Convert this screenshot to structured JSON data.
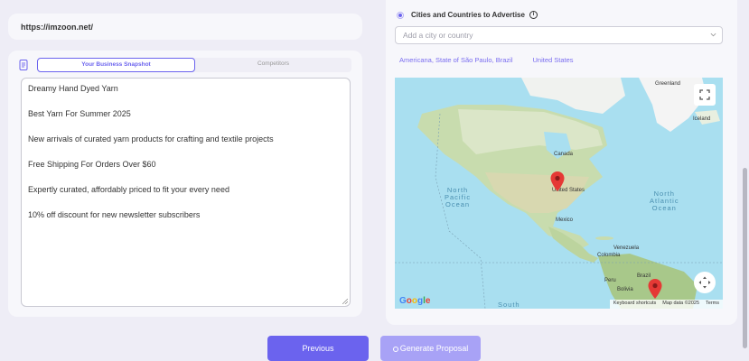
{
  "url_card": {
    "url": "https://imzoon.net/"
  },
  "snapshot": {
    "tabs": [
      {
        "label": "Your Business Snapshot",
        "active": true
      },
      {
        "label": "Competitors",
        "active": false
      }
    ],
    "lines": [
      "Dreamy Hand Dyed Yarn",
      "Best Yarn For Summer 2025",
      "New arrivals of curated yarn products for crafting and textile projects",
      "Free Shipping For Orders Over $60",
      "Expertly curated, affordably priced to fit your every need",
      "10% off discount for new newsletter subscribers"
    ]
  },
  "targeting": {
    "title": "Cities and Countries to Advertise",
    "info_icon": "i",
    "placeholder": "Add a city or country",
    "chips": [
      "Americana, State of São Paulo, Brazil",
      "United States"
    ]
  },
  "map": {
    "labels": {
      "greenland": "Greenland",
      "iceland": "Iceland",
      "canada": "Canada",
      "united_states": "United States",
      "mexico": "Mexico",
      "venezuela": "Venezuela",
      "colombia": "Colombia",
      "peru": "Peru",
      "brazil": "Brazil",
      "bolivia": "Bolivia"
    },
    "oceans": {
      "north_pacific": "North\nPacific\nOcean",
      "north_atlantic": "North\nAtlantic\nOcean",
      "south": "South"
    },
    "google": "Google",
    "footer": {
      "shortcuts": "Keyboard shortcuts",
      "data": "Map data ©2025",
      "terms": "Terms"
    }
  },
  "buttons": {
    "previous": "Previous",
    "generate": "Generate Proposal"
  },
  "colors": {
    "accent": "#6b63ee",
    "accent_light": "#a8a2f6",
    "pin": "#e53935"
  }
}
